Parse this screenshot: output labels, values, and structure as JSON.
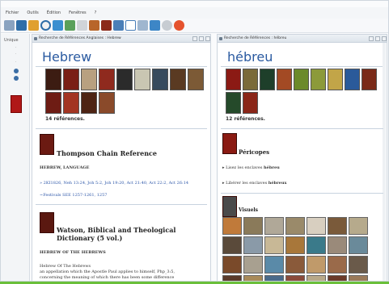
{
  "menu": [
    "Fichier",
    "Outils",
    "Édition",
    "Fenêtres",
    "?"
  ],
  "toolbar_icons": [
    "book-icon",
    "save-icon",
    "lock-icon",
    "search-icon",
    "chat-icon",
    "chart-icon",
    "page-icon",
    "person-icon",
    "book-icon",
    "grid-icon",
    "layout-icon",
    "copy-icon",
    "monitor-icon",
    "gear-icon",
    "close-icon"
  ],
  "leftrail": {
    "label": "Unique"
  },
  "left_pane": {
    "header": "Recherche de Références Anglaises : Hebrew",
    "title": "Hebrew",
    "ref_count": "14 références.",
    "sections": [
      {
        "title": "Thompson Chain Reference",
        "subtitle": "HEBREW, LANGUAGE",
        "line1": "» 2KI1826, Neh 13:24, Joh 5:2, Joh 19:20, Act 21:40, Act 22:2, Act 26:14",
        "line2": "~Festivals SEE 1257-1261, 1257"
      },
      {
        "title": "Watson, Biblical and Theological Dictionary (5 vol.)",
        "subtitle": "HEBREW OF THE HEBREWS",
        "line1": "Hebrew Of The Hebrews",
        "line2": "an appellation which the Apostle Paul applies to himself, Php_3:5,",
        "line3": "concerning the meaning of which there has been some difference"
      }
    ]
  },
  "right_pane": {
    "header": "Recherche de Références : hébreu",
    "title": "hébreu",
    "ref_count": "12 références.",
    "pericopes_title": "Péricopes",
    "pericopes": [
      {
        "prefix": "Lisez les enclaves ",
        "bold": "hébreu"
      },
      {
        "prefix": "Libérer les enclaves ",
        "bold": "hébreux"
      }
    ],
    "visuals_title": "Visuels"
  },
  "colors": {
    "accent": "#2a5aa0",
    "status_bar": "#6abf3a"
  }
}
